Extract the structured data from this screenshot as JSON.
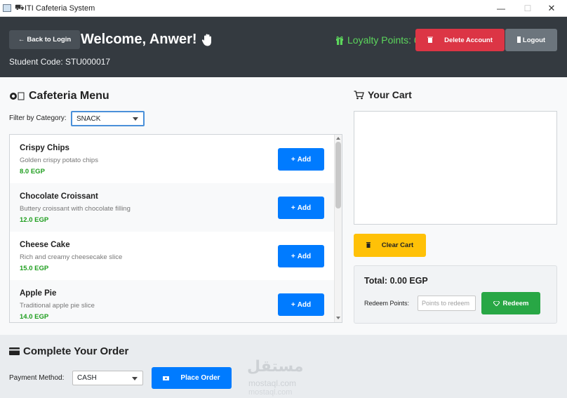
{
  "window": {
    "title": "ITI Cafeteria System",
    "minimize": "—",
    "maximize": "☐",
    "close": "✕"
  },
  "header": {
    "back_label": "Back to Login",
    "welcome": "Welcome, Anwer!",
    "student_code": "Student Code: STU000017",
    "loyalty": "Loyalty Points: 0",
    "delete_label": "Delete Account",
    "logout_label": "Logout"
  },
  "menu": {
    "title": "Cafeteria Menu",
    "filter_label": "Filter by Category:",
    "category": "SNACK",
    "add_label": "Add",
    "items": [
      {
        "name": "Crispy Chips",
        "description": "Golden crispy potato chips",
        "price": "8.0 EGP"
      },
      {
        "name": "Chocolate Croissant",
        "description": "Buttery croissant with chocolate filling",
        "price": "12.0 EGP"
      },
      {
        "name": "Cheese Cake",
        "description": "Rich and creamy cheesecake slice",
        "price": "15.0 EGP"
      },
      {
        "name": "Apple Pie",
        "description": "Traditional apple pie slice",
        "price": "14.0 EGP"
      }
    ]
  },
  "cart": {
    "title": "Your Cart",
    "clear_label": "Clear Cart",
    "total": "Total: 0.00 EGP",
    "redeem_label": "Redeem Points:",
    "redeem_placeholder": "Points to redeem",
    "redeem_button": "Redeem"
  },
  "order": {
    "title": "Complete Your Order",
    "payment_label": "Payment Method:",
    "payment_method": "CASH",
    "place_label": "Place Order"
  },
  "watermark": {
    "logo_text": "مستقل",
    "site": "mostaql.com"
  },
  "colors": {
    "header_bg": "#343a40",
    "primary": "#007bff",
    "danger": "#dc3545",
    "warning": "#ffc107",
    "success": "#28a745",
    "secondary": "#6c757d",
    "loyalty": "#5cd65c",
    "price": "#1e9e1e"
  },
  "icons": {
    "app": "window-icon",
    "back": "left-arrow-icon",
    "wave": "waving-hand-icon",
    "gift": "gift-icon",
    "trash": "trash-icon",
    "door": "door-icon",
    "plate": "plate-icon",
    "cart": "cart-icon",
    "plus": "plus-icon",
    "gem": "gem-icon",
    "card": "credit-card-icon",
    "cash": "cash-icon"
  }
}
